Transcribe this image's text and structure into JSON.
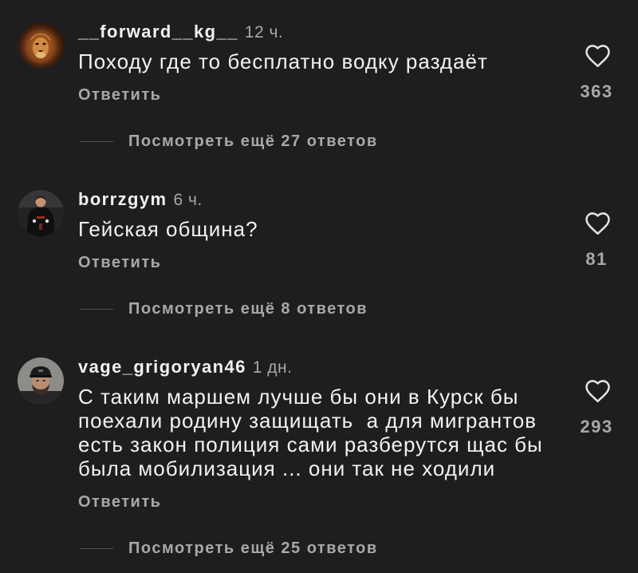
{
  "colors": {
    "background": "#1e1e20",
    "text": "#f2f2f2",
    "muted": "#a8a8a8",
    "divider": "#505052",
    "heart_stroke": "#e2e2e2"
  },
  "icons": {
    "like": "heart-outline-icon"
  },
  "comments": [
    {
      "username": "__forward__kg__",
      "time": "12 ч.",
      "text": "Походу где то бесплатно водку раздаёт",
      "reply_label": "Ответить",
      "likes": 363,
      "view_replies": "Посмотреть ещё 27 ответов"
    },
    {
      "username": "borrzgym",
      "time": "6 ч.",
      "text": "Гейская община?",
      "reply_label": "Ответить",
      "likes": 81,
      "view_replies": "Посмотреть ещё 8 ответов"
    },
    {
      "username": "vage_grigoryan46",
      "time": "1 дн.",
      "text": "С таким маршем лучше бы они в Курск бы\nпоехали родину защищать  а для мигрантов\nесть закон полиция сами разберутся щас бы\nбыла мобилизация ... они так не ходили",
      "reply_label": "Ответить",
      "likes": 293,
      "view_replies": "Посмотреть ещё 25 ответов"
    }
  ]
}
